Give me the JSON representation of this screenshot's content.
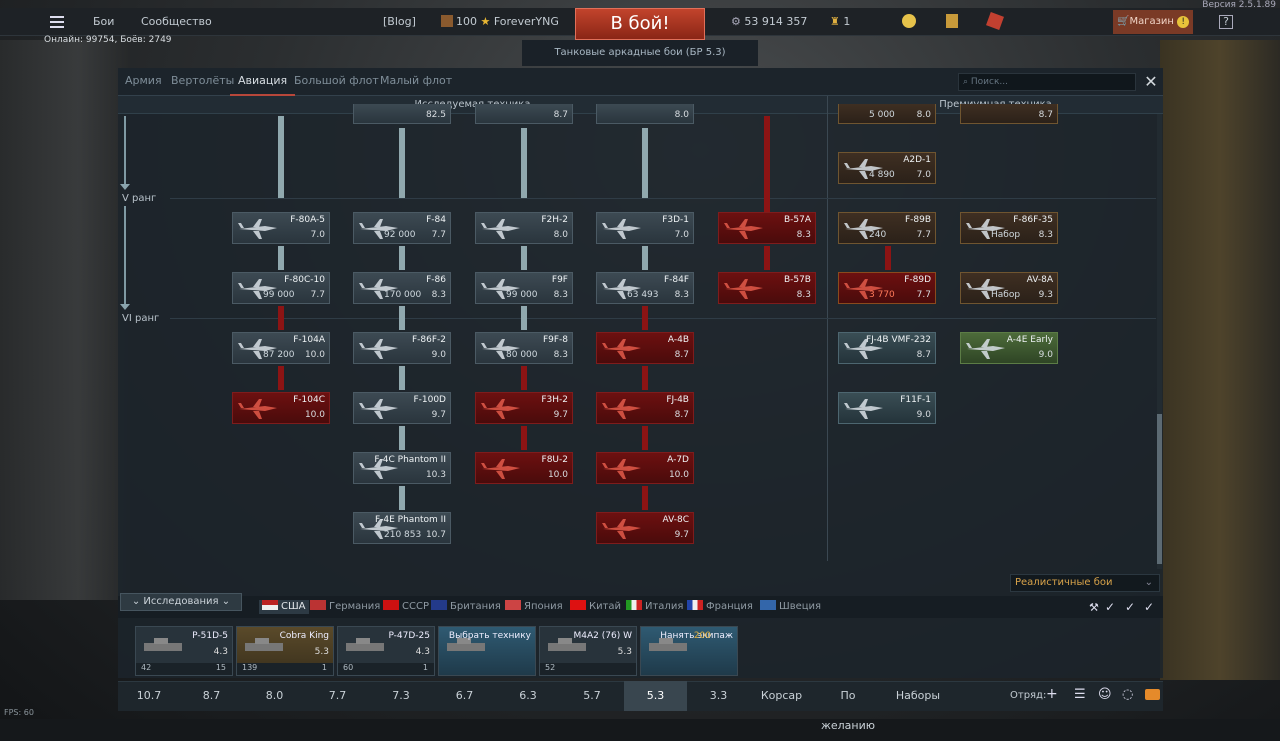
{
  "version": "Версия 2.5.1.89",
  "topbar": {
    "battles": "Бои",
    "community": "Сообщество",
    "blog": "[Blog]",
    "level": "100",
    "username": "ForeverYNG",
    "battle_button": "В бой!",
    "silver": "53 914 357",
    "gold": "1",
    "shop": "Магазин",
    "help": "?"
  },
  "online": "Онлайн: 99754, Боёв: 2749",
  "mode": "Танковые аркадные бои (БР 5.3)",
  "tabs": [
    "Армия",
    "Вертолёты",
    "Авиация",
    "Большой флот",
    "Малый флот"
  ],
  "active_tab": "Авиация",
  "search_placeholder": "Поиск...",
  "columns": {
    "research": "Исследуемая техника",
    "premium": "Премиумная техника"
  },
  "ranks": {
    "r5": "V ранг",
    "r6": "VI ранг"
  },
  "top_partial": {
    "c2": "82.5",
    "c3": "8.7",
    "c4": "8.0",
    "p1_rp": "5 000",
    "p1_br": "8.0",
    "p2_br": "8.7"
  },
  "cards": {
    "f80a5": {
      "name": "F-80A-5",
      "br": "7.0"
    },
    "f84": {
      "name": "F-84",
      "br": "7.7",
      "rp": "92 000"
    },
    "f2h2": {
      "name": "F2H-2",
      "br": "8.0"
    },
    "f3d1": {
      "name": "F3D-1",
      "br": "7.0"
    },
    "b57a": {
      "name": "B-57A",
      "br": "8.3"
    },
    "f80c10": {
      "name": "F-80C-10",
      "br": "7.7",
      "rp": "99 000"
    },
    "f86": {
      "name": "F-86",
      "br": "8.3",
      "rp": "170 000"
    },
    "f9f": {
      "name": "F9F",
      "br": "8.3",
      "rp": "99 000"
    },
    "f84f": {
      "name": "F-84F",
      "br": "8.3",
      "rp": "63 493"
    },
    "b57b": {
      "name": "B-57B",
      "br": "8.3"
    },
    "f104a": {
      "name": "F-104A",
      "br": "10.0",
      "rp": "87 200"
    },
    "f86f2": {
      "name": "F-86F-2",
      "br": "9.0"
    },
    "f9f8": {
      "name": "F9F-8",
      "br": "8.3",
      "rp": "80 000"
    },
    "a4b": {
      "name": "A-4B",
      "br": "8.7"
    },
    "f104c": {
      "name": "F-104C",
      "br": "10.0"
    },
    "f100d": {
      "name": "F-100D",
      "br": "9.7"
    },
    "f3h2": {
      "name": "F3H-2",
      "br": "9.7"
    },
    "fj4b": {
      "name": "FJ-4B",
      "br": "8.7"
    },
    "f4c": {
      "name": "F-4C Phantom II",
      "br": "10.3"
    },
    "f8u2": {
      "name": "F8U-2",
      "br": "10.0"
    },
    "a7d": {
      "name": "A-7D",
      "br": "10.0"
    },
    "f4e": {
      "name": "F-4E Phantom II",
      "br": "10.7",
      "rp": "210 853"
    },
    "av8c": {
      "name": "AV-8C",
      "br": "9.7"
    },
    "a2d1": {
      "name": "A2D-1",
      "br": "7.0",
      "rp": "4 890"
    },
    "f89b": {
      "name": "F-89B",
      "br": "7.7",
      "rp": "240"
    },
    "f86f35": {
      "name": "F-86F-35",
      "br": "8.3",
      "rp": "Набор"
    },
    "f89d": {
      "name": "F-89D",
      "br": "7.7",
      "rp": "3 770"
    },
    "av8a": {
      "name": "AV-8A",
      "br": "9.3",
      "rp": "Набор"
    },
    "fj4bvmf": {
      "name": "FJ-4B VMF-232",
      "br": "8.7"
    },
    "a4e": {
      "name": "A-4E Early",
      "br": "9.0"
    },
    "f11f1": {
      "name": "F11F-1",
      "br": "9.0"
    }
  },
  "research_tab": "Исследования",
  "countries": [
    "США",
    "Германия",
    "СССР",
    "Британия",
    "Япония",
    "Китай",
    "Италия",
    "Франция",
    "Швеция"
  ],
  "realistic": "Реалистичные бои",
  "slots": [
    {
      "name": "P-51D-5",
      "br": "4.3",
      "left": "42",
      "right": "15"
    },
    {
      "name": "Cobra King",
      "br": "5.3",
      "left": "139",
      "right": "1"
    },
    {
      "name": "P-47D-25",
      "br": "4.3",
      "left": "60",
      "right": "1"
    },
    {
      "name": "Выбрать технику"
    },
    {
      "name": "M4A2 (76) W",
      "br": "5.3",
      "left": "52"
    },
    {
      "name": "Нанять экипаж",
      "cost": "200"
    }
  ],
  "br_buttons": [
    "10.7",
    "8.7",
    "8.0",
    "7.7",
    "7.3",
    "6.7",
    "6.3",
    "5.7",
    "5.3",
    "3.3",
    "Корсар",
    "По желанию",
    "Наборы"
  ],
  "squad": "Отряд:",
  "fps": "FPS: 60",
  "colors": {
    "accent": "#b8473a",
    "locked": "#6d1010",
    "premium": "#3f2f22"
  }
}
